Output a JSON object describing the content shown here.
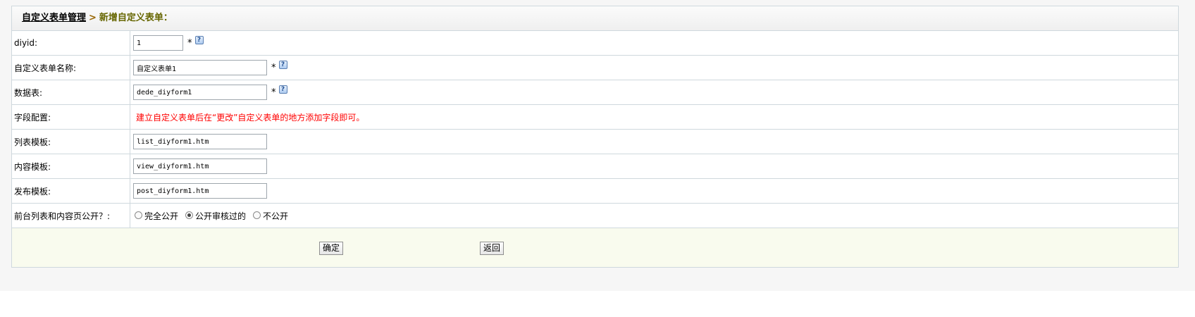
{
  "breadcrumb": {
    "parent": "自定义表单管理",
    "separator": ">",
    "current": "新增自定义表单："
  },
  "rows": {
    "diyid": {
      "label": "diyid:",
      "value": "1",
      "required": "*"
    },
    "name": {
      "label": "自定义表单名称:",
      "value": "自定义表单1",
      "required": "*"
    },
    "table": {
      "label": "数据表:",
      "value": "dede_diyform1",
      "required": "*"
    },
    "fields": {
      "label": "字段配置:",
      "note": "建立自定义表单后在“更改”自定义表单的地方添加字段即可。"
    },
    "list_template": {
      "label": "列表模板:",
      "value": "list_diyform1.htm"
    },
    "content_template": {
      "label": "内容模板:",
      "value": "view_diyform1.htm"
    },
    "post_template": {
      "label": "发布模板:",
      "value": "post_diyform1.htm"
    },
    "public": {
      "label": "前台列表和内容页公开？:",
      "options": [
        "完全公开",
        "公开审核过的",
        "不公开"
      ],
      "selected": "公开审核过的"
    }
  },
  "buttons": {
    "confirm": "确定",
    "back": "返回"
  },
  "icons": {
    "help": "help-icon"
  }
}
